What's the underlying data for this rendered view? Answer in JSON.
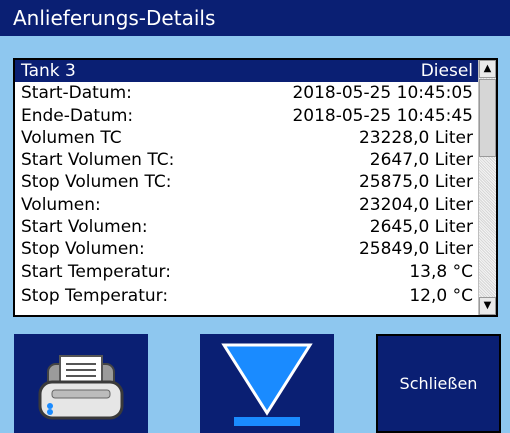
{
  "window": {
    "title": "Anlieferungs-Details"
  },
  "details": {
    "rows": [
      {
        "label": "Tank 3",
        "value": "Diesel"
      },
      {
        "label": "Start-Datum:",
        "value": "2018-05-25 10:45:05"
      },
      {
        "label": "Ende-Datum:",
        "value": "2018-05-25 10:45:45"
      },
      {
        "label": "Volumen TC",
        "value": "23228,0 Liter"
      },
      {
        "label": "Start Volumen TC:",
        "value": "2647,0 Liter"
      },
      {
        "label": "Stop Volumen TC:",
        "value": "25875,0 Liter"
      },
      {
        "label": "Volumen:",
        "value": "23204,0 Liter"
      },
      {
        "label": "Start Volumen:",
        "value": "2645,0 Liter"
      },
      {
        "label": "Stop Volumen:",
        "value": "25849,0 Liter"
      },
      {
        "label": "Start Temperatur:",
        "value": "13,8 °C"
      },
      {
        "label": "Stop Temperatur:",
        "value": "12,0 °C"
      }
    ],
    "selected_index": 0
  },
  "buttons": {
    "print_icon": "printer-icon",
    "download_icon": "download-icon",
    "close_label": "Schließen"
  },
  "colors": {
    "accent": "#0a1f73",
    "background": "#8ec7ef",
    "highlight": "#1a8bff"
  }
}
